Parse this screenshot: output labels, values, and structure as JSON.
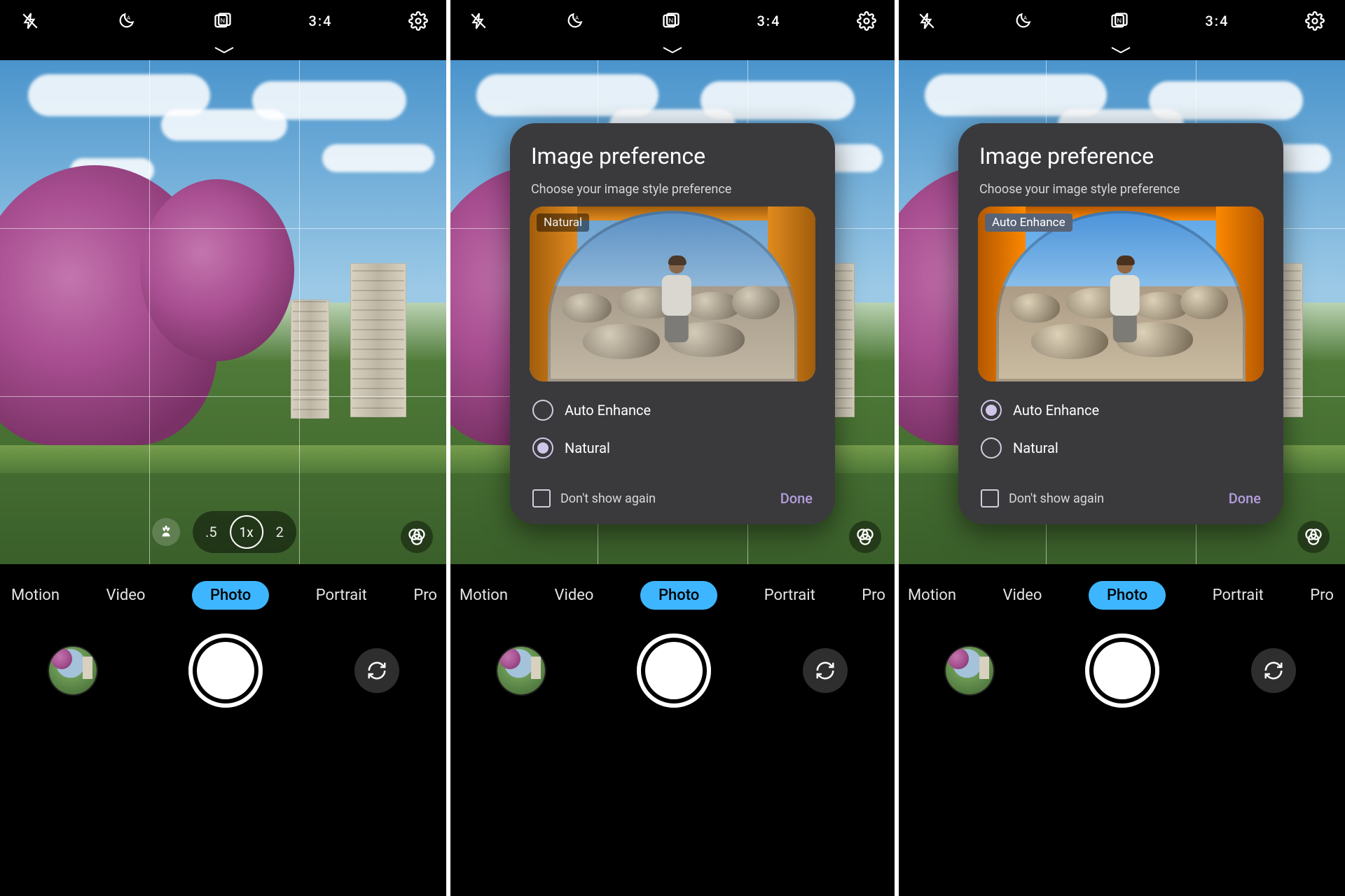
{
  "topbar": {
    "ratio": "3:4"
  },
  "zoom": {
    "half": ".5",
    "one": "1x",
    "two": "2"
  },
  "modes": {
    "motion": "Motion",
    "video": "Video",
    "photo": "Photo",
    "portrait": "Portrait",
    "pro": "Pro"
  },
  "dialog": {
    "title": "Image preference",
    "subtitle": "Choose your image style preference",
    "tag_natural": "Natural",
    "tag_enhance": "Auto Enhance",
    "opt_enhance": "Auto Enhance",
    "opt_natural": "Natural",
    "dont_show": "Don't show again",
    "done": "Done"
  }
}
